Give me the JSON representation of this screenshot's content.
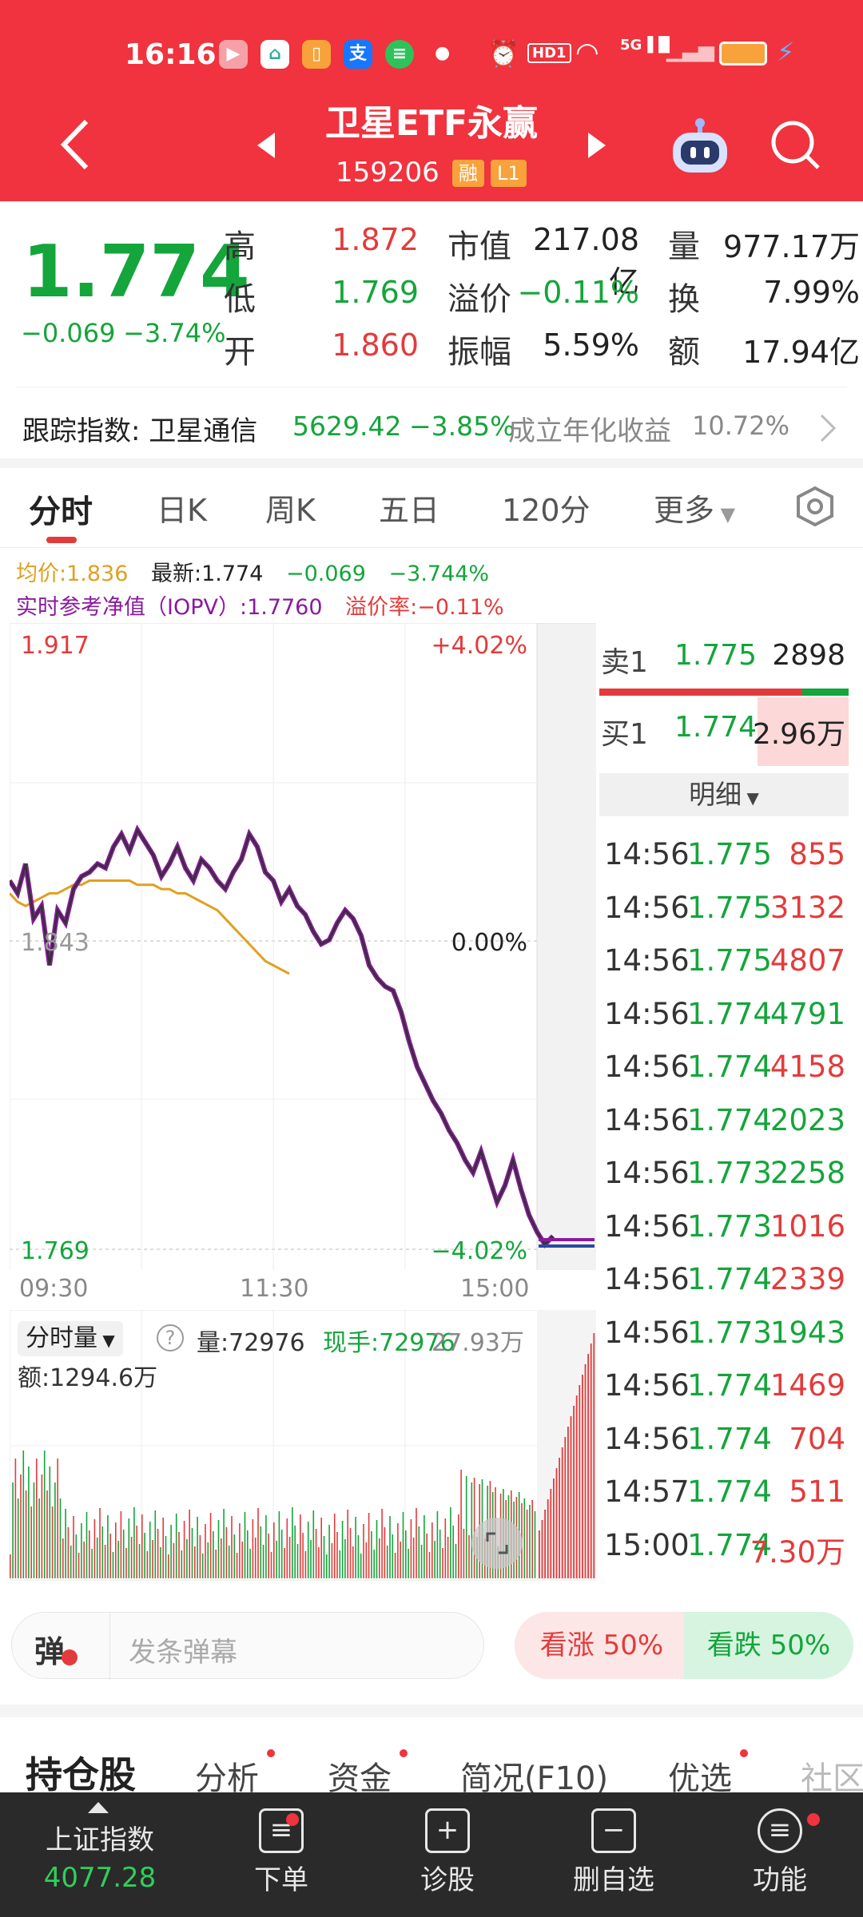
{
  "status_bar": {
    "time": "16:16",
    "network": "5G",
    "icons": [
      "video-app-icon",
      "home-app-icon",
      "book-app-icon",
      "alipay-app-icon",
      "chat-app-icon",
      "dot-icon",
      "alarm-icon",
      "hd-icon",
      "wifi-icon",
      "signal-5g-icon",
      "signal-x-icon",
      "battery-icon",
      "charging-icon"
    ],
    "hd_label": "HD1"
  },
  "header": {
    "title": "卫星ETF永赢",
    "code": "159206",
    "tag_margin": "融",
    "tag_level": "L1"
  },
  "quote": {
    "price": "1.774",
    "change": "−0.069",
    "change_pct": "−3.74%",
    "high_label": "高",
    "high": "1.872",
    "low_label": "低",
    "low": "1.769",
    "open_label": "开",
    "open": "1.860",
    "mcap_label": "市值",
    "mcap": "217.08亿",
    "premium_label": "溢价",
    "premium": "−0.11%",
    "amplitude_label": "振幅",
    "amplitude": "5.59%",
    "vol_label": "量",
    "vol": "977.17万",
    "turnover_label": "换",
    "turnover": "7.99%",
    "amount_label": "额",
    "amount": "17.94亿"
  },
  "tracking": {
    "label": "跟踪指数: 卫星通信",
    "value": "5629.42",
    "pct": "−3.85%",
    "annual_label": "成立年化收益",
    "annual": "10.72%"
  },
  "tabs": [
    "分时",
    "日K",
    "周K",
    "五日",
    "120分",
    "更多"
  ],
  "info_line": {
    "avg_label": "均价:1.836",
    "latest": "最新:1.774",
    "chg": "−0.069",
    "chg_pct": "−3.744%"
  },
  "iopv_line": {
    "iopv": "实时参考净值（IOPV）:1.7760",
    "prem": "溢价率:−0.11%"
  },
  "chart_data": {
    "type": "line",
    "y_top": "1.917",
    "y_mid": "1.843",
    "y_bottom": "1.769",
    "pct_top": "+4.02%",
    "pct_mid": "0.00%",
    "pct_bottom": "−4.02%",
    "x_labels": [
      "09:30",
      "11:30",
      "15:00"
    ],
    "ylim": [
      1.769,
      1.917
    ],
    "series": [],
    "price": [
      1.858,
      1.855,
      1.862,
      1.849,
      1.852,
      1.838,
      1.851,
      1.848,
      1.856,
      1.859,
      1.86,
      1.862,
      1.861,
      1.866,
      1.869,
      1.865,
      1.87,
      1.867,
      1.864,
      1.859,
      1.862,
      1.866,
      1.861,
      1.858,
      1.863,
      1.861,
      1.858,
      1.856,
      1.86,
      1.863,
      1.869,
      1.866,
      1.86,
      1.858,
      1.853,
      1.856,
      1.852,
      1.85,
      1.846,
      1.843,
      1.844,
      1.848,
      1.851,
      1.849,
      1.845,
      1.838,
      1.835,
      1.833,
      1.832,
      1.827,
      1.82,
      1.814,
      1.81,
      1.806,
      1.803,
      1.799,
      1.796,
      1.792,
      1.789,
      1.794,
      1.788,
      1.782,
      1.786,
      1.792,
      1.785,
      1.779,
      1.775,
      1.772,
      1.774
    ],
    "avg": [
      1.855,
      1.853,
      1.852,
      1.853,
      1.854,
      1.855,
      1.855,
      1.856,
      1.857,
      1.857,
      1.858,
      1.858,
      1.858,
      1.858,
      1.858,
      1.858,
      1.857,
      1.857,
      1.857,
      1.856,
      1.856,
      1.855,
      1.855,
      1.854,
      1.853,
      1.852,
      1.851,
      1.849,
      1.847,
      1.845,
      1.843,
      1.841,
      1.839,
      1.838,
      1.837,
      1.836
    ],
    "volume_label": "分时量",
    "volume": "量:72976",
    "hand": "现手:72976",
    "vol_max": "27.93万",
    "amount": "额:1294.6万"
  },
  "orderbook": {
    "sell_label": "卖1",
    "sell_price": "1.775",
    "sell_qty": "2898",
    "buy_label": "买1",
    "buy_price": "1.774",
    "buy_qty": "2.96万",
    "detail_label": "明细",
    "trades": [
      {
        "time": "14:56",
        "price": "1.775",
        "qty": "855",
        "dir": "up"
      },
      {
        "time": "14:56",
        "price": "1.775",
        "qty": "3132",
        "dir": "up"
      },
      {
        "time": "14:56",
        "price": "1.775",
        "qty": "4807",
        "dir": "up"
      },
      {
        "time": "14:56",
        "price": "1.774",
        "qty": "4791",
        "dir": "down"
      },
      {
        "time": "14:56",
        "price": "1.774",
        "qty": "4158",
        "dir": "up"
      },
      {
        "time": "14:56",
        "price": "1.774",
        "qty": "2023",
        "dir": "down"
      },
      {
        "time": "14:56",
        "price": "1.773",
        "qty": "2258",
        "dir": "down"
      },
      {
        "time": "14:56",
        "price": "1.773",
        "qty": "1016",
        "dir": "up"
      },
      {
        "time": "14:56",
        "price": "1.774",
        "qty": "2339",
        "dir": "up"
      },
      {
        "time": "14:56",
        "price": "1.773",
        "qty": "1943",
        "dir": "down"
      },
      {
        "time": "14:56",
        "price": "1.774",
        "qty": "1469",
        "dir": "up"
      },
      {
        "time": "14:56",
        "price": "1.774",
        "qty": "704",
        "dir": "up"
      },
      {
        "time": "14:57",
        "price": "1.774",
        "qty": "511",
        "dir": "up"
      },
      {
        "time": "15:00",
        "price": "1.774",
        "qty": "7.30万",
        "dir": "up"
      }
    ]
  },
  "danmaku": {
    "icon_label": "弹",
    "placeholder": "发条弹幕",
    "bull": "看涨 50%",
    "bear": "看跌 50%"
  },
  "subtabs": [
    "持仓股",
    "分析",
    "资金",
    "简况(F10)",
    "优选",
    "社区"
  ],
  "bottom_nav": {
    "index_label": "上证指数",
    "index_value": "4077.28",
    "items": [
      "下单",
      "诊股",
      "删自选",
      "功能"
    ]
  },
  "colors": {
    "up": "#e33b3b",
    "down": "#14a53b",
    "header": "#f0333e",
    "price_line": "#333333",
    "iopv_line": "#8a1a9e",
    "avg_line": "#e0a020"
  }
}
